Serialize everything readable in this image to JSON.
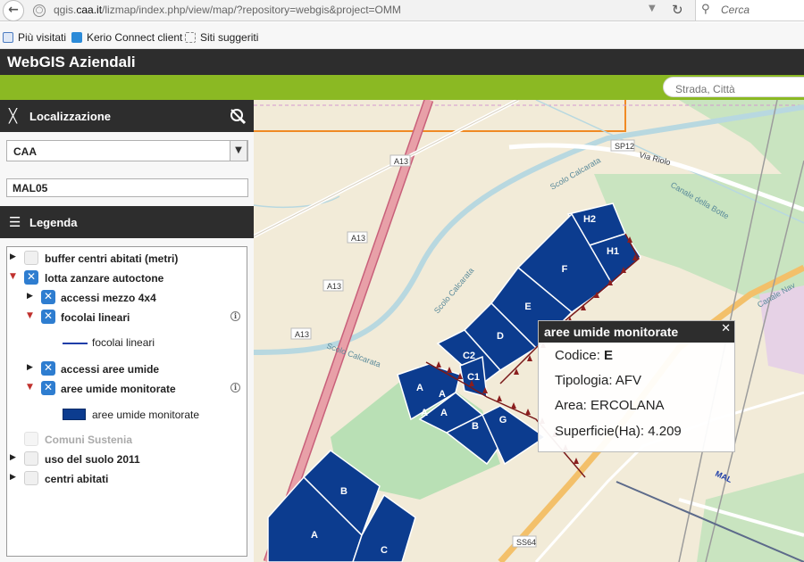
{
  "browser": {
    "url_prefix": "qgis.",
    "url_host": "caa.it",
    "url_rest": "/lizmap/index.php/view/map/?repository=webgis&project=OMM",
    "search_placeholder": "Cerca",
    "bookmarks": [
      "Più visitati",
      "Kerio Connect client",
      "Siti suggeriti"
    ]
  },
  "app": {
    "title": "WebGIS Aziendali",
    "search_placeholder": "Strada, Città"
  },
  "localizzazione": {
    "title": "Localizzazione",
    "select_value": "CAA",
    "field_value": "MAL05"
  },
  "legend": {
    "title": "Legenda",
    "items": [
      {
        "label": "buffer centri abitati (metri)",
        "checked": false,
        "expanded": false
      },
      {
        "label": "lotta zanzare autoctone",
        "checked": true,
        "expanded": true
      },
      {
        "label": "accessi mezzo 4x4",
        "checked": true,
        "expanded": false
      },
      {
        "label": "focolai lineari",
        "checked": true,
        "expanded": true,
        "symbol": "focolai lineari"
      },
      {
        "label": "accessi aree umide",
        "checked": true,
        "expanded": false
      },
      {
        "label": "aree umide monitorate",
        "checked": true,
        "expanded": true,
        "symbol": "aree umide monitorate"
      },
      {
        "label": "Comuni Sustenia",
        "checked": false,
        "disabled": true
      },
      {
        "label": "uso del suolo 2011",
        "checked": false,
        "expanded": false
      },
      {
        "label": "centri abitati",
        "checked": false,
        "expanded": false
      }
    ]
  },
  "map": {
    "road_labels": [
      "A13",
      "A13",
      "A13",
      "A13",
      "SP12",
      "Via Riolo",
      "Canale della Botte",
      "Scolo Calcarata",
      "Scolo Calcarata",
      "Scolo Calcarata",
      "Canale Nav",
      "SS64",
      "MAL"
    ],
    "parcel_labels": [
      "H2",
      "H1",
      "F",
      "E",
      "D",
      "C2",
      "C1",
      "A",
      "A",
      "A",
      "A",
      "B",
      "G",
      "B",
      "A",
      "C"
    ],
    "colors": {
      "parcel": "#0c3c8f",
      "green": "#c9e4c0",
      "road": "#e8a0a8",
      "water": "#b8d8e0"
    }
  },
  "popup": {
    "title": "aree umide monitorate",
    "codice_label": "Codice:",
    "codice_value": "E",
    "tipologia_label": "Tipologia:",
    "tipologia_value": "AFV",
    "area_label": "Area:",
    "area_value": "ERCOLANA",
    "superficie_label": "Superficie(Ha):",
    "superficie_value": "4.209"
  }
}
